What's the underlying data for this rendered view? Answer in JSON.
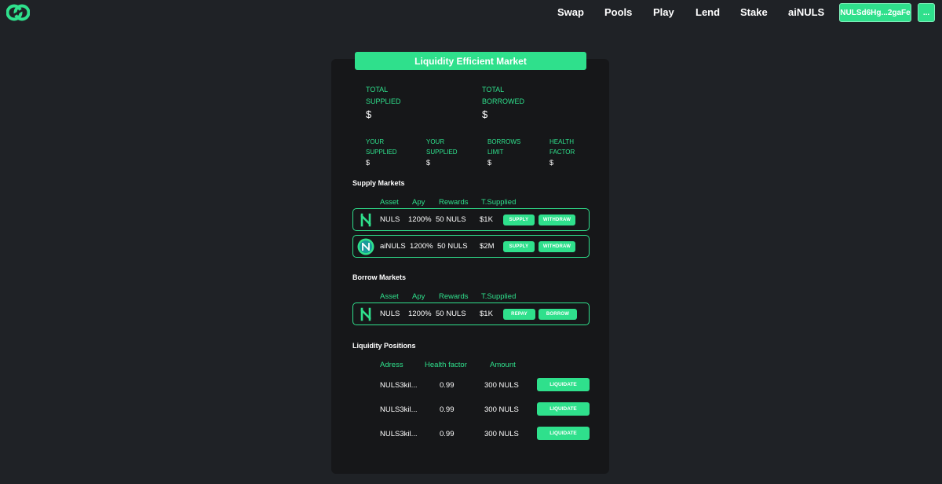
{
  "nav": {
    "links": [
      "Swap",
      "Pools",
      "Play",
      "Lend",
      "Stake",
      "aiNULS"
    ],
    "wallet": "NULSd6Hg...2gaFe",
    "more": "..."
  },
  "market": {
    "title": "Liquidity Efficient Market",
    "total_supplied_label_1": "TOTAL",
    "total_supplied_label_2": "SUPPLIED",
    "total_supplied_value": "$",
    "total_borrowed_label_1": "TOTAL",
    "total_borrowed_label_2": "BORROWED",
    "total_borrowed_value": "$",
    "stats": [
      {
        "l1": "YOUR",
        "l2": "SUPPLIED",
        "value": "$"
      },
      {
        "l1": "YOUR",
        "l2": "SUPPLIED",
        "value": "$"
      },
      {
        "l1": "BORROWS",
        "l2": "LIMIT",
        "value": "$"
      },
      {
        "l1": "HEALTH",
        "l2": "FACTOR",
        "value": "$"
      }
    ]
  },
  "supply": {
    "title": "Supply Markets",
    "headers": [
      "Asset",
      "Apy",
      "Rewards",
      "T.Supplied"
    ],
    "rows": [
      {
        "asset": "NULS",
        "apy": "1200%",
        "rewards": "50 NULS",
        "total": "$1K",
        "btn1": "SUPPLY",
        "btn2": "WITHDRAW"
      },
      {
        "asset": "aiNULS",
        "apy": "1200%",
        "rewards": "50 NULS",
        "total": "$2M",
        "btn1": "SUPPLY",
        "btn2": "WITHDRAW"
      }
    ]
  },
  "borrow": {
    "title": "Borrow Markets",
    "headers": [
      "Asset",
      "Apy",
      "Rewards",
      "T.Supplied"
    ],
    "rows": [
      {
        "asset": "NULS",
        "apy": "1200%",
        "rewards": "50 NULS",
        "total": "$1K",
        "btn1": "REPAY",
        "btn2": "BORROW"
      }
    ]
  },
  "positions": {
    "title": "Liquidity Positions",
    "headers": [
      "Adress",
      "Health factor",
      "Amount"
    ],
    "rows": [
      {
        "address": "NULS3kil...",
        "health": "0.99",
        "amount": "300 NULS",
        "btn": "LIQUIDATE"
      },
      {
        "address": "NULS3kil...",
        "health": "0.99",
        "amount": "300 NULS",
        "btn": "LIQUIDATE"
      },
      {
        "address": "NULS3kil...",
        "health": "0.99",
        "amount": "300 NULS",
        "btn": "LIQUIDATE"
      }
    ]
  },
  "colors": {
    "accent": "#2fe08c",
    "background": "#1f2226",
    "card": "#161719"
  }
}
